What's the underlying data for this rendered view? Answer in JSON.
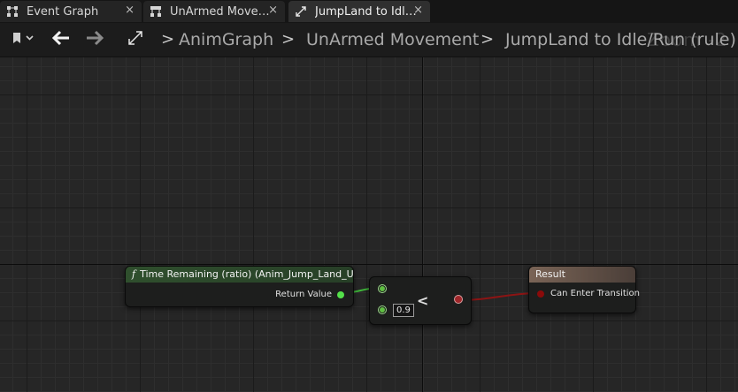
{
  "tabs": [
    {
      "label": "Event Graph",
      "icon": "event-graph-icon",
      "close": "×"
    },
    {
      "label": "UnArmed Move…",
      "icon": "state-machine-icon",
      "close": "×"
    },
    {
      "label": "JumpLand to Idl…",
      "icon": "transition-icon",
      "close": "×",
      "active": true
    }
  ],
  "breadcrumb": {
    "separator": ">",
    "items": [
      "AnimGraph",
      "UnArmed Movement",
      "JumpLand to Idle/Run (rule)"
    ]
  },
  "zoom": "Zoom -2",
  "nodes": {
    "time_remaining": {
      "icon": "f",
      "title": "Time Remaining (ratio) (Anim_Jump_Land_UA)",
      "output_label": "Return Value",
      "header_color": "#2c4a2c"
    },
    "compare": {
      "operator": "<",
      "default_value": "0.9"
    },
    "result": {
      "title": "Result",
      "input_label": "Can Enter Transition",
      "header_color": "#6e5a4e"
    }
  },
  "colors": {
    "float_pin": "#5fbf42",
    "bool_pin": "#8a0a0a",
    "float_wire": "#3fb53a",
    "bool_wire": "#8c1414"
  }
}
